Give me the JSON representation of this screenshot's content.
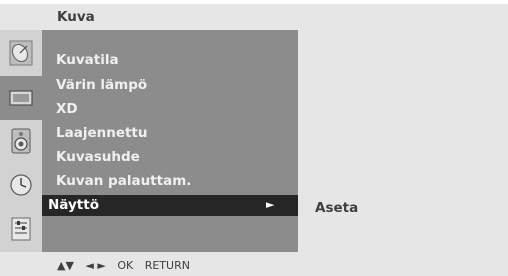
{
  "header": {
    "title": "Kuva"
  },
  "sidebar": {
    "icons": [
      {
        "name": "satellite-dish-icon",
        "active": false
      },
      {
        "name": "tv-screen-icon",
        "active": true
      },
      {
        "name": "speaker-icon",
        "active": false
      },
      {
        "name": "clock-icon",
        "active": false
      },
      {
        "name": "settings-list-icon",
        "active": false
      }
    ]
  },
  "menu": {
    "items": [
      {
        "label": "Kuvatila"
      },
      {
        "label": "Värin lämpö"
      },
      {
        "label": "XD"
      },
      {
        "label": "Laajennettu"
      },
      {
        "label": "Kuvasuhde"
      },
      {
        "label": "Kuvan palauttam."
      },
      {
        "label": "Näyttö",
        "arrow": "►",
        "selected": true
      }
    ]
  },
  "submenu": {
    "items": [
      {
        "label": "Aseta"
      }
    ]
  },
  "footer": {
    "nav_updown": "▲▼",
    "nav_leftright": "◄ ►",
    "ok": "OK",
    "return": "RETURN"
  },
  "colors": {
    "menu_bg": "#8c8c8c",
    "selected_bg": "#262626",
    "bar_bg": "#e6e6e6",
    "icon_strip_bg": "#d2d2d2"
  }
}
